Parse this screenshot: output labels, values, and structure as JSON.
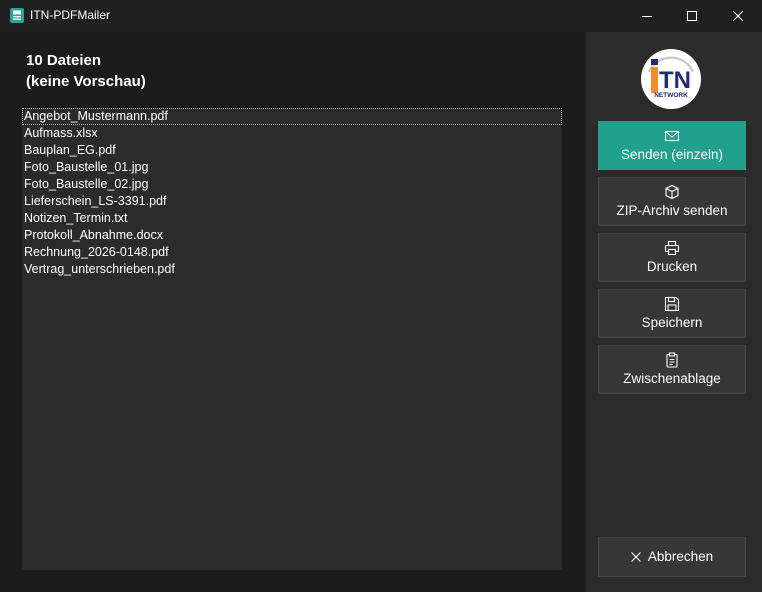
{
  "window": {
    "title": "ITN-PDFMailer"
  },
  "header": {
    "count_line": "10 Dateien",
    "preview_line": "(keine Vorschau)"
  },
  "files": [
    "Angebot_Mustermann.pdf",
    "Aufmass.xlsx",
    "Bauplan_EG.pdf",
    "Foto_Baustelle_01.jpg",
    "Foto_Baustelle_02.jpg",
    "Lieferschein_LS-3391.pdf",
    "Notizen_Termin.txt",
    "Protokoll_Abnahme.docx",
    "Rechnung_2026-0148.pdf",
    "Vertrag_unterschrieben.pdf"
  ],
  "logo": {
    "text": "ITN",
    "subtext": "NETWORK"
  },
  "actions": {
    "send_single": {
      "label": "Senden (einzeln)",
      "icon": "envelope-icon"
    },
    "send_zip": {
      "label": "ZIP-Archiv senden",
      "icon": "package-icon"
    },
    "print": {
      "label": "Drucken",
      "icon": "printer-icon"
    },
    "save": {
      "label": "Speichern",
      "icon": "floppy-disk-icon"
    },
    "clipboard": {
      "label": "Zwischenablage",
      "icon": "clipboard-icon"
    }
  },
  "cancel": {
    "label": "Abbrechen",
    "icon": "close-icon"
  },
  "colors": {
    "accent": "#21a08e",
    "panel": "#2b2b2b",
    "background": "#1c1c1c",
    "logo_orange": "#f28c28",
    "logo_navy": "#1e2d6b"
  }
}
